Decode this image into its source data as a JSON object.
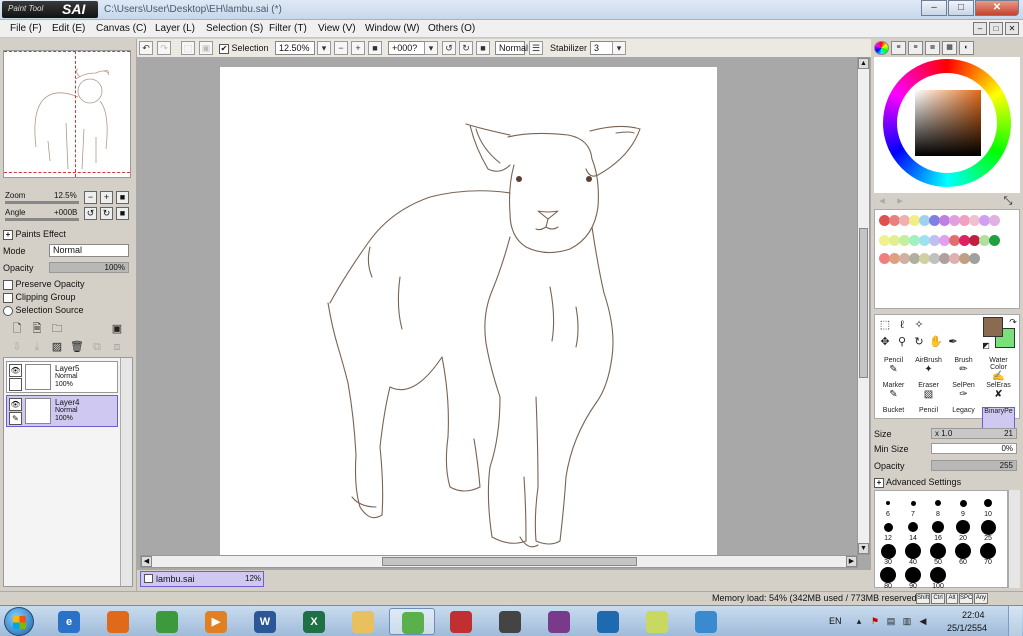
{
  "window": {
    "app_logo_small": "Paint Tool",
    "app_logo_big": "SAI",
    "title": "C:\\Users\\User\\Desktop\\EH\\lambu.sai (*)",
    "minimize": "–",
    "maximize": "□",
    "close": "✕"
  },
  "menu": [
    {
      "label": "File (F)"
    },
    {
      "label": "Edit (E)"
    },
    {
      "label": "Canvas (C)"
    },
    {
      "label": "Layer (L)"
    },
    {
      "label": "Selection (S)"
    },
    {
      "label": "Filter (T)"
    },
    {
      "label": "View (V)"
    },
    {
      "label": "Window (W)"
    },
    {
      "label": "Others (O)"
    }
  ],
  "toolbar": {
    "selection_checked": "✔",
    "selection_label": "Selection",
    "zoom_value": "12.50%",
    "angle_value": "+000?",
    "blend_mode": "Normal",
    "stabilizer_label": "Stabilizer",
    "stabilizer_value": "3"
  },
  "navigator": {
    "zoom_label": "Zoom",
    "zoom_value": "12.5%",
    "angle_label": "Angle",
    "angle_value": "+000B"
  },
  "layer_props": {
    "paints_effect": "Paints Effect",
    "mode_label": "Mode",
    "mode_value": "Normal",
    "opacity_label": "Opacity",
    "opacity_value": "100%",
    "opacity_fraction": 1.0,
    "preserve_opacity": "Preserve Opacity",
    "clipping_group": "Clipping Group",
    "selection_source": "Selection Source"
  },
  "layers": [
    {
      "name": "Layer5",
      "mode": "Normal",
      "opacity": "100%"
    },
    {
      "name": "Layer4",
      "mode": "Normal",
      "opacity": "100%"
    }
  ],
  "document": {
    "tab_name": "lambu.sai",
    "tab_zoom": "12%"
  },
  "color": {
    "current_primary": "#8a6a50",
    "current_secondary": "#7ae07a",
    "swatches_row1": [
      "#e05050",
      "#e88080",
      "#f0b0b0",
      "#f0f080",
      "#a0d0f0",
      "#8080e0",
      "#c080e0",
      "#e0a0e0",
      "#f0a0c0",
      "#f0c0d0",
      "#d0a0f0",
      "#e0b0e0"
    ],
    "swatches_row2": [
      "#f0f090",
      "#e0f090",
      "#c0f0a0",
      "#a0f0c0",
      "#a0e0f0",
      "#c0c0f0",
      "#e0a0f0",
      "#e07070",
      "#e02060",
      "#c02040",
      "#b0e0a0",
      "#20a040"
    ],
    "swatches_row3": [
      "#f08080",
      "#e0a080",
      "#d0b0a0",
      "#b0b0a0",
      "#d0d0a0",
      "#c0c0c0",
      "#b0a0a0",
      "#e0b0b0",
      "#c0a080",
      "#a0a0a0"
    ]
  },
  "tools": [
    {
      "label": "Pencil",
      "icon": "✎"
    },
    {
      "label": "AirBrush",
      "icon": "✦"
    },
    {
      "label": "Brush",
      "icon": "✏"
    },
    {
      "label": "Water Color",
      "icon": "✍"
    },
    {
      "label": "Marker",
      "icon": "✎"
    },
    {
      "label": "Eraser",
      "icon": "▧"
    },
    {
      "label": "SelPen",
      "icon": "✑"
    },
    {
      "label": "SelEras",
      "icon": "✘"
    },
    {
      "label": "Bucket",
      "icon": ""
    },
    {
      "label": "Pencil",
      "icon": ""
    },
    {
      "label": "Legacy",
      "icon": ""
    },
    {
      "label": "BinaryPe",
      "icon": ""
    }
  ],
  "brush": {
    "size_label": "Size",
    "size_mult": "x 1.0",
    "size_value": "21",
    "min_size_label": "Min Size",
    "min_size_value": "0%",
    "density_label": "Opacity",
    "density_value": "255",
    "advanced": "Advanced Settings",
    "sizes": [
      "6",
      "7",
      "8",
      "9",
      "10",
      "12",
      "14",
      "16",
      "20",
      "25",
      "30",
      "40",
      "50",
      "60",
      "70",
      "80",
      "90",
      "100"
    ]
  },
  "status": {
    "memory": "Memory load: 54% (342MB used / 773MB reserved)",
    "keys": [
      "Shift",
      "Ctrl",
      "Alt",
      "SPC",
      "Any"
    ]
  },
  "taskbar": {
    "apps": [
      {
        "name": "internet-explorer",
        "glyph": "e",
        "color": "#2a72c8"
      },
      {
        "name": "firefox",
        "glyph": "",
        "color": "#e06a1a"
      },
      {
        "name": "chrome",
        "glyph": "",
        "color": "#3c9a3c"
      },
      {
        "name": "media-player",
        "glyph": "▶",
        "color": "#e08020"
      },
      {
        "name": "word",
        "glyph": "W",
        "color": "#2b5797"
      },
      {
        "name": "excel",
        "glyph": "X",
        "color": "#1e7145"
      },
      {
        "name": "explorer",
        "glyph": "",
        "color": "#e8c060"
      },
      {
        "name": "paint-tool-sai",
        "glyph": "",
        "color": "#5ab04a"
      },
      {
        "name": "picasa",
        "glyph": "",
        "color": "#c03030"
      },
      {
        "name": "movie-maker",
        "glyph": "",
        "color": "#444"
      },
      {
        "name": "winrar",
        "glyph": "",
        "color": "#7a3a8a"
      },
      {
        "name": "messenger",
        "glyph": "",
        "color": "#1e6ab0"
      },
      {
        "name": "sticky-notes",
        "glyph": "",
        "color": "#c8d860"
      },
      {
        "name": "app-cubes",
        "glyph": "",
        "color": "#3a8ad0"
      }
    ],
    "lang": "EN",
    "time": "22:04",
    "date": "25/1/2554"
  }
}
